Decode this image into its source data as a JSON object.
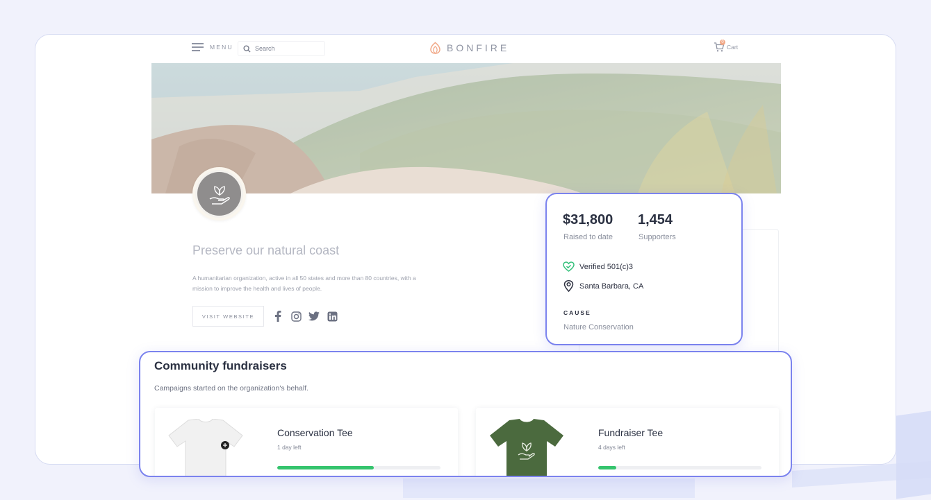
{
  "header": {
    "menu_label": "MENU",
    "search_placeholder": "Search",
    "logo_text": "BONFIRE",
    "cart_label": "Cart",
    "cart_count": "0"
  },
  "organization": {
    "name": "Preserve our natural coast",
    "description": "A humanitarian organization, active in all 50 states and more than 80 countries, with a mission to improve the health and lives of people.",
    "visit_label": "VISIT WEBSITE",
    "socials": [
      "facebook-icon",
      "instagram-icon",
      "twitter-icon",
      "linkedin-icon"
    ]
  },
  "stats": {
    "raised_value": "$31,800",
    "raised_label": "Raised to date",
    "supporters_value": "1,454",
    "supporters_label": "Supporters",
    "verified_label": "Verified 501(c)3",
    "location_label": "Santa Barbara, CA",
    "cause_heading": "CAUSE",
    "cause_value": "Nature Conservation"
  },
  "community": {
    "title": "Community fundraisers",
    "subtitle": "Campaigns started on the organization's behalf.",
    "items": [
      {
        "name": "Conservation Tee",
        "time_left": "1 day left",
        "progress": 0.59,
        "shirt_color": "#f1f1f1"
      },
      {
        "name": "Fundraiser Tee",
        "time_left": "4 days left",
        "progress": 0.11,
        "shirt_color": "#4b6a3e"
      }
    ]
  },
  "colors": {
    "accent": "#7b83ee",
    "progress": "#35c46d",
    "verified": "#33c07a",
    "logo": "#f1a988",
    "background": "#f1f2fc"
  }
}
